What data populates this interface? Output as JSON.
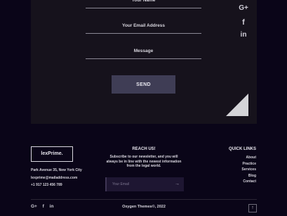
{
  "contact_form": {
    "name_label": "Your Name",
    "email_label": "Your Email Address",
    "message_label": "Message",
    "send_label": "SEND"
  },
  "social_side": [
    "G+",
    "f",
    "in"
  ],
  "footer": {
    "logo": "lexPrime.",
    "address": "Park Avenue 35, New York City",
    "email": "lexprime@mailaddress.com",
    "phone": "+1 917 123 456 789",
    "reach_title": "REACH US!",
    "reach_desc": "Subscribe to our newsletter, and you will always be in line with the newest information from the legal world.",
    "email_placeholder": "Your Email",
    "quick_title": "QUICK LINKS",
    "quick_links": [
      "About",
      "Practice",
      "Services",
      "Blog",
      "Contact"
    ],
    "copyright": "Oxygen Themes©, 2022"
  },
  "social_bottom": [
    "G+",
    "f",
    "in"
  ]
}
